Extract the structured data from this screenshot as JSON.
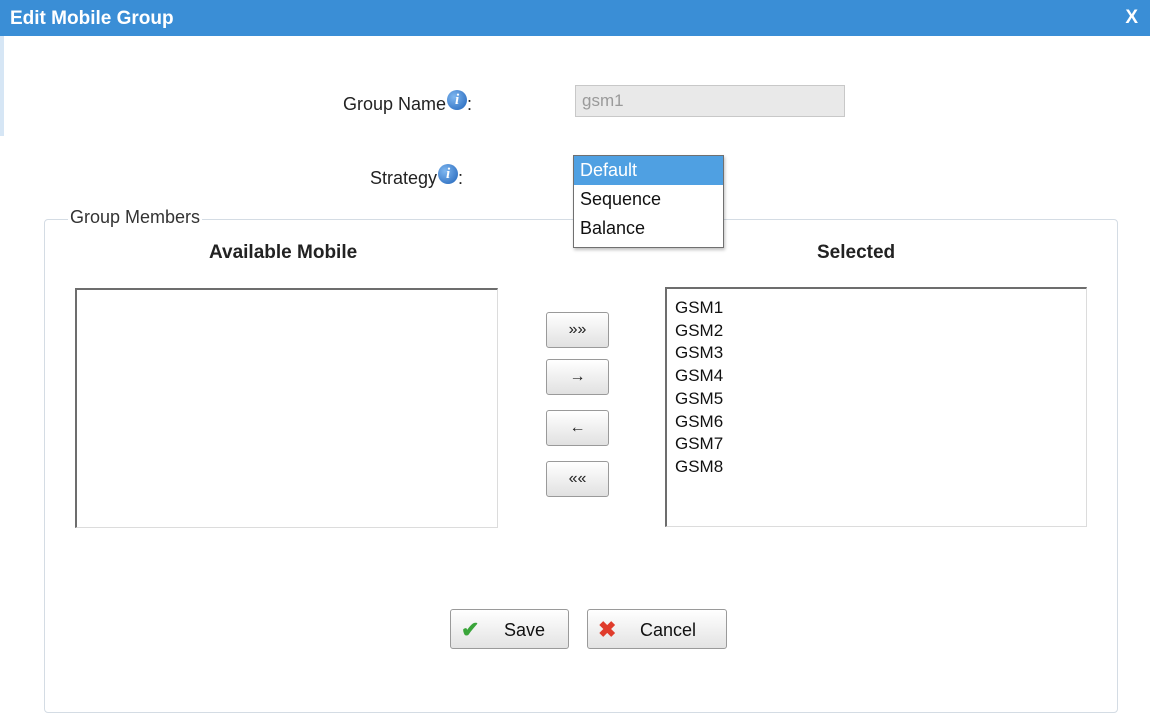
{
  "dialog": {
    "title": "Edit Mobile Group",
    "close_label": "X"
  },
  "group_name": {
    "label": "Group Name",
    "colon": ":",
    "value": "gsm1"
  },
  "strategy": {
    "label": "Strategy",
    "colon": ":",
    "options": [
      "Default",
      "Sequence",
      "Balance"
    ],
    "selected": "Default"
  },
  "group_members": {
    "legend": "Group Members",
    "available_header": "Available Mobile",
    "selected_header": "Selected",
    "available_items": [],
    "selected_items": [
      "GSM1",
      "GSM2",
      "GSM3",
      "GSM4",
      "GSM5",
      "GSM6",
      "GSM7",
      "GSM8"
    ]
  },
  "move_buttons": {
    "add_all": "»»",
    "add": "→",
    "remove": "←",
    "remove_all": "««"
  },
  "actions": {
    "save_label": "Save",
    "cancel_label": "Cancel"
  },
  "icons": {
    "info": "i",
    "save": "✔",
    "cancel": "✖"
  },
  "colors": {
    "titlebar": "#3a8ed6",
    "selected_option": "#4fa0e2",
    "save_check": "#3aa53a",
    "cancel_x": "#e03c2c"
  }
}
